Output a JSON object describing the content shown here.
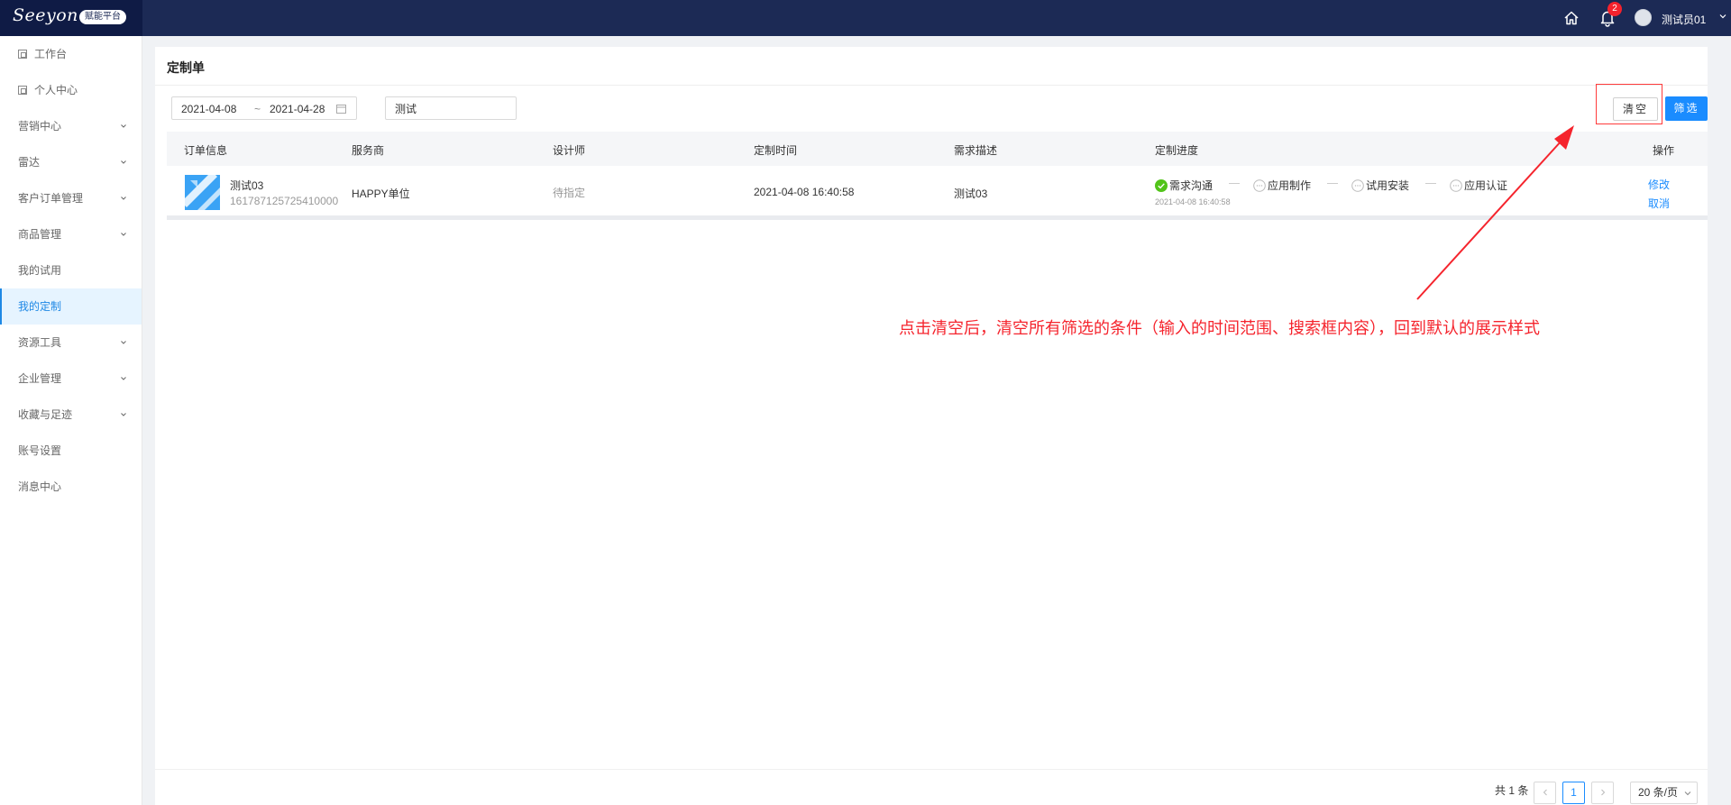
{
  "header": {
    "logo_text": "Seeyon",
    "platform_badge": "赋能平台",
    "notification_count": "2",
    "username": "测试员01"
  },
  "sidebar": {
    "items": [
      {
        "label": "工作台",
        "has_icon": true,
        "expandable": false
      },
      {
        "label": "个人中心",
        "has_icon": true,
        "expandable": false
      },
      {
        "label": "营销中心",
        "expandable": true
      },
      {
        "label": "雷达",
        "expandable": true
      },
      {
        "label": "客户订单管理",
        "expandable": true
      },
      {
        "label": "商品管理",
        "expandable": true
      },
      {
        "label": "我的试用",
        "expandable": false
      },
      {
        "label": "我的定制",
        "expandable": false,
        "active": true
      },
      {
        "label": "资源工具",
        "expandable": true
      },
      {
        "label": "企业管理",
        "expandable": true
      },
      {
        "label": "收藏与足迹",
        "expandable": true
      },
      {
        "label": "账号设置",
        "expandable": false
      },
      {
        "label": "消息中心",
        "expandable": false
      }
    ]
  },
  "page": {
    "title": "定制单"
  },
  "filters": {
    "date_start": "2021-04-08",
    "date_separator": "~",
    "date_end": "2021-04-28",
    "search_value": "测试",
    "clear_label": "清空",
    "filter_label": "筛选"
  },
  "table": {
    "columns": [
      "订单信息",
      "服务商",
      "设计师",
      "定制时间",
      "需求描述",
      "定制进度",
      "操作"
    ],
    "rows": [
      {
        "order_name": "测试03",
        "order_no": "161787125725410000",
        "provider": "HAPPY单位",
        "designer": "待指定",
        "time": "2021-04-08 16:40:58",
        "description": "测试03",
        "progress": {
          "steps": [
            {
              "label": "需求沟通",
              "done": true
            },
            {
              "label": "应用制作",
              "done": false
            },
            {
              "label": "试用安装",
              "done": false
            },
            {
              "label": "应用认证",
              "done": false
            }
          ],
          "first_step_date": "2021-04-08 16:40:58"
        },
        "actions": [
          "修改",
          "取消"
        ]
      }
    ]
  },
  "annotation": {
    "text": "点击清空后，清空所有筛选的条件（输入的时间范围、搜索框内容），回到默认的展示样式",
    "color": "#f5242d"
  },
  "pagination": {
    "total_text": "共 1 条",
    "current_page": "1",
    "page_size": "20 条/页"
  },
  "colors": {
    "header_bg": "#1c2a55",
    "primary": "#1a8cff",
    "success": "#52c41a",
    "annotation": "#f5242d"
  }
}
